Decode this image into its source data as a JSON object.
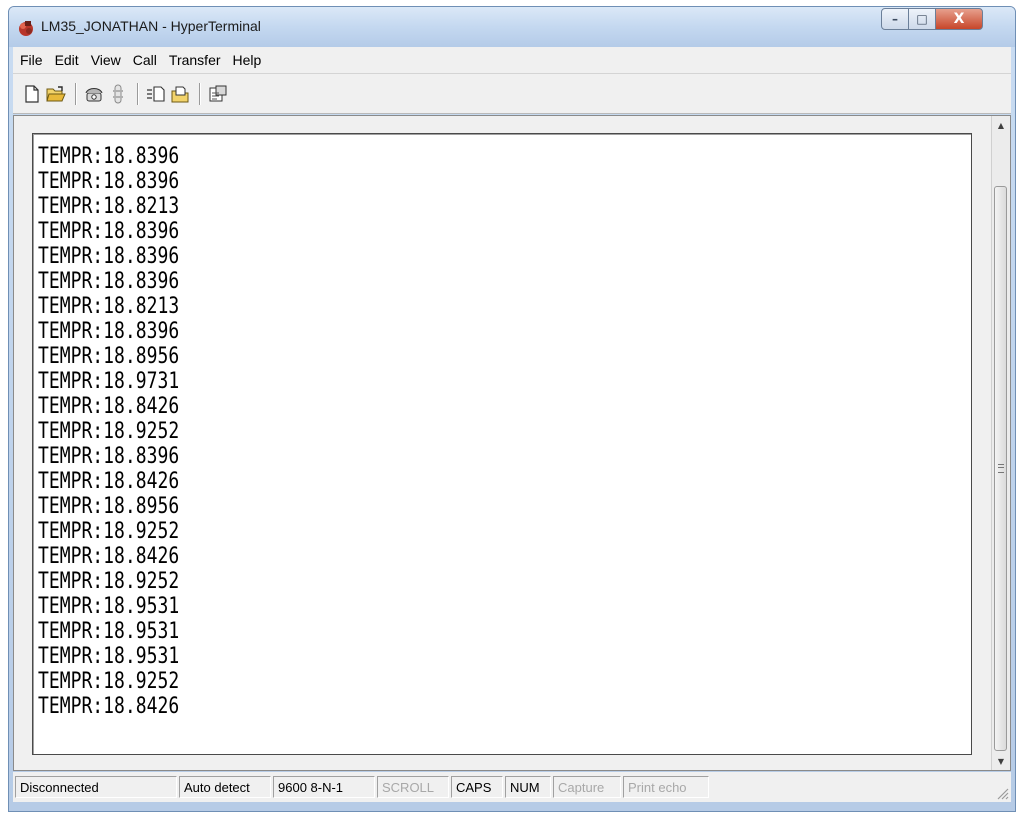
{
  "window": {
    "title": "LM35_JONATHAN - HyperTerminal",
    "controls": {
      "minimize": "–",
      "maximize": "□",
      "close": "X"
    }
  },
  "menu": {
    "items": [
      "File",
      "Edit",
      "View",
      "Call",
      "Transfer",
      "Help"
    ]
  },
  "toolbar": {
    "icons": [
      "new-document-icon",
      "open-folder-icon",
      "call-icon",
      "disconnect-icon",
      "send-file-icon",
      "receive-file-icon",
      "properties-icon"
    ]
  },
  "terminal": {
    "lines": [
      "TEMPR:18.8396",
      "TEMPR:18.8396",
      "TEMPR:18.8213",
      "TEMPR:18.8396",
      "TEMPR:18.8396",
      "TEMPR:18.8396",
      "TEMPR:18.8213",
      "TEMPR:18.8396",
      "TEMPR:18.8956",
      "TEMPR:18.9731",
      "TEMPR:18.8426",
      "TEMPR:18.9252",
      "TEMPR:18.8396",
      "TEMPR:18.8426",
      "TEMPR:18.8956",
      "TEMPR:18.9252",
      "TEMPR:18.8426",
      "TEMPR:18.9252",
      "TEMPR:18.9531",
      "TEMPR:18.9531",
      "TEMPR:18.9531",
      "TEMPR:18.9252",
      "TEMPR:18.8426"
    ]
  },
  "statusbar": {
    "connection": "Disconnected",
    "detect": "Auto detect",
    "settings": "9600 8-N-1",
    "scroll": "SCROLL",
    "caps": "CAPS",
    "num": "NUM",
    "capture": "Capture",
    "print_echo": "Print echo"
  }
}
